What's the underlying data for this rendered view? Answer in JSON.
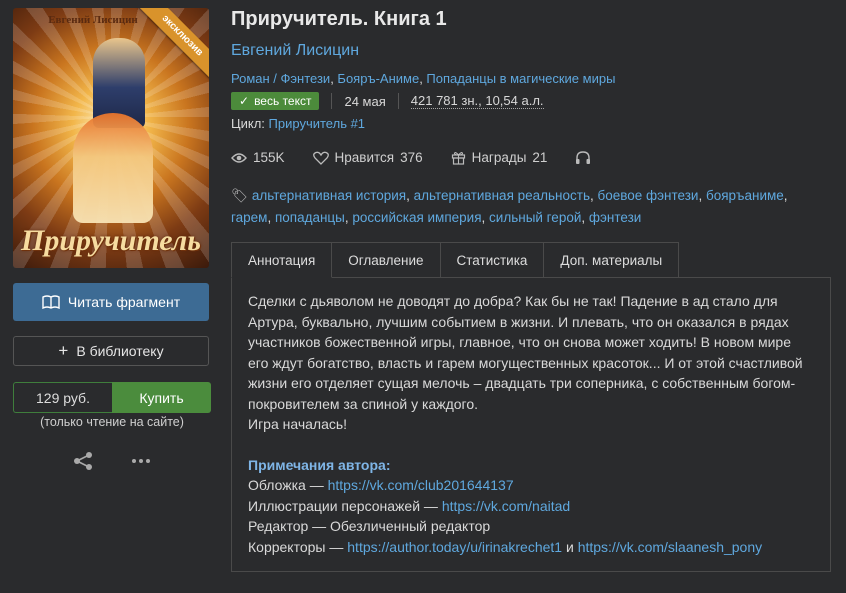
{
  "cover": {
    "author": "Евгений Лисицин",
    "title": "Приручитель",
    "ribbon": "эксклюзив"
  },
  "left": {
    "read_label": "Читать фрагмент",
    "library_label": "В библиотеку",
    "price": "129 руб.",
    "buy_label": "Купить",
    "note": "(только чтение на сайте)"
  },
  "book": {
    "title": "Приручитель. Книга 1",
    "author": "Евгений Лисицин",
    "genres": [
      "Роман / Фэнтези",
      "Бояръ-Аниме",
      "Попаданцы в магические миры"
    ],
    "badge": "весь текст",
    "date": "24 мая",
    "size": "421 781 зн., 10,54 а.л.",
    "cycle_label": "Цикл:",
    "cycle_value": "Приручитель #1"
  },
  "stats": {
    "views": "155K",
    "likes_label": "Нравится",
    "likes": "376",
    "awards_label": "Награды",
    "awards": "21"
  },
  "tags": [
    "альтернативная история",
    "альтернативная реальность",
    "боевое фэнтези",
    "бояръаниме",
    "гарем",
    "попаданцы",
    "российская империя",
    "сильный герой",
    "фэнтези"
  ],
  "tabs": [
    "Аннотация",
    "Оглавление",
    "Статистика",
    "Доп. материалы"
  ],
  "annotation": {
    "text": "Сделки с дьяволом не доводят до добра? Как бы не так! Падение в ад стало для Артура, буквально, лучшим событием в жизни. И плевать, что он оказался в рядах участников божественной игры, главное, что он снова может ходить! В новом мире его ждут богатство, власть и гарем могущественных красоток... И от этой счастливой жизни его отделяет сущая мелочь – двадцать три соперника, с собственным богом-покровителем за спиной у каждого.",
    "last_line": "Игра началась!",
    "notes_heading": "Примечания автора:",
    "cover_label": "Обложка — ",
    "cover_link": "https://vk.com/club201644137",
    "illus_label": "Иллюстрации персонажей — ",
    "illus_link": "https://vk.com/naitad",
    "editor": "Редактор — Обезличенный редактор",
    "proof_label": "Корректоры — ",
    "proof_link1": "https://author.today/u/irinakrechet1",
    "proof_and": " и ",
    "proof_link2": "https://vk.com/slaanesh_pony"
  },
  "colors": {
    "accent": "#5fa8de",
    "read_btn": "#3d6b94",
    "buy_btn": "#4b8c3d",
    "badge": "#4c8b3b"
  }
}
